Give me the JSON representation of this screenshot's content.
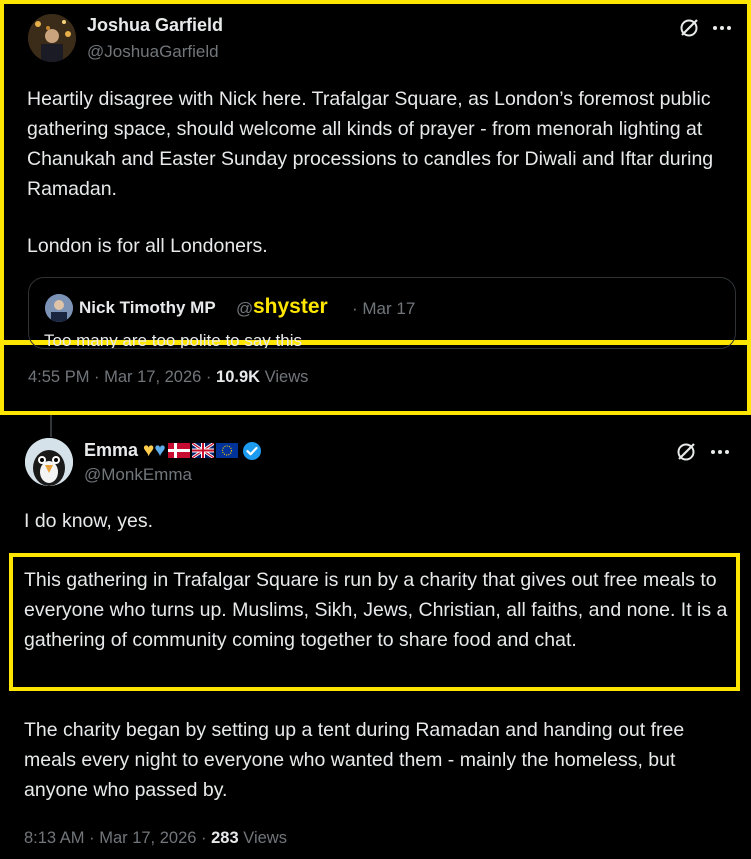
{
  "tweet1": {
    "name": "Joshua Garfield",
    "handle": "@JoshuaGarfield",
    "paragraph1": "Heartily disagree with Nick here. Trafalgar Square, as London’s foremost public gathering space, should welcome all kinds of prayer - from menorah lighting at Chanukah and Easter Sunday processions to candles for Diwali and Iftar during Ramadan.",
    "paragraph2": "London is for all Londoners.",
    "quote": {
      "name": "Nick Timothy MP",
      "handle_prefix": "@",
      "overlay_label": "shyster",
      "date": "· Mar 17",
      "text": "Too many are too polite to say this"
    },
    "timestamp": "4:55 PM · Mar 17, 2026 ·",
    "views_count": "10.9K",
    "views_label": "Views"
  },
  "tweet2": {
    "name": "Emma",
    "handle": "@MonkEmma",
    "paragraph1": "I do know, yes.",
    "highlighted": "This gathering in Trafalgar Square is run by a charity that gives out free meals to everyone who turns up. Muslims, Sikh, Jews, Christian, all faiths, and none. It is a gathering of community coming together to share food and chat.",
    "paragraph3": "The charity began by setting up a tent during Ramadan and handing out free meals every night to everyone who wanted them - mainly the homeless, but anyone who passed by.",
    "timestamp": "8:13 AM · Mar 17, 2026 ·",
    "views_count": "283",
    "views_label": "Views"
  },
  "icons": {
    "grok": "grok-icon",
    "more": "more-icon",
    "verified": "verified-badge-icon"
  },
  "colors": {
    "highlight": "#ffe600",
    "background": "#000000",
    "text": "#e7e9ea",
    "muted": "#71767b",
    "verified": "#1d9bf0"
  }
}
